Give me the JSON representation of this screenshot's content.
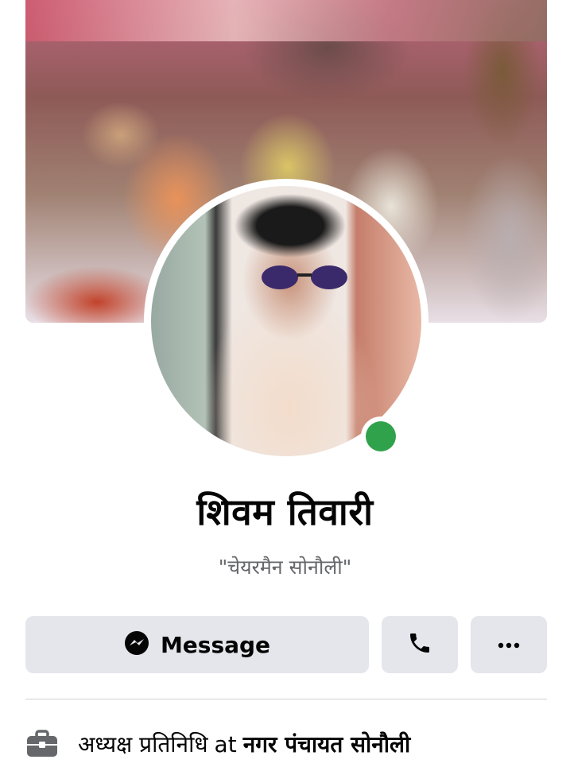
{
  "profile": {
    "name": "शिवम तिवारी",
    "subtitle": "\"चेयरमैन सोनौली\"",
    "online": true
  },
  "actions": {
    "message_label": "Message",
    "call_icon": "phone-icon",
    "more_icon": "more-icon"
  },
  "work": {
    "icon": "briefcase-icon",
    "role": "अध्यक्ष प्रतिनिधि",
    "at": "at",
    "organization": "नगर पंचायत सोनौली"
  },
  "colors": {
    "online": "#31a24c",
    "button_bg": "#e4e6eb",
    "secondary_text": "#65676b"
  }
}
